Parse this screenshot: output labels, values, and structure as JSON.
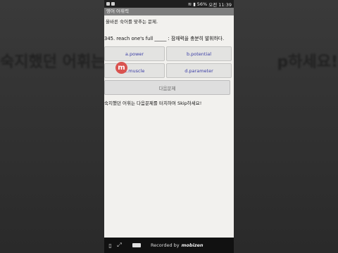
{
  "background_echo": {
    "left_text": "숙지했던 어휘는 다",
    "right_text": "p하세요!"
  },
  "statusbar": {
    "left_glyph": "▫",
    "battery": "56%",
    "time_label": "오전 11:39"
  },
  "app": {
    "title": "영어 어휘력",
    "instruction": "올바른 숙어를 맞추는 문제.",
    "question": "345. reach one's full _____ : 잠재력을 충분히 발휘하다.",
    "choices": [
      {
        "label": "a.power"
      },
      {
        "label": "b.potential"
      },
      {
        "label": "c.muscle"
      },
      {
        "label": "d.parameter"
      }
    ],
    "next_button": "다음문제",
    "hint": "숙지했던 어휘는 다음문제를 터치하여 Skip하세요!"
  },
  "overlay": {
    "rec_badge": "m"
  },
  "navbar": {
    "recorded_label": "Recorded by",
    "brand": "mobizen"
  },
  "colors": {
    "choice_text": "#3b3ea6",
    "titlebar": "#7d7d7d",
    "rec_badge": "#d9534f"
  }
}
